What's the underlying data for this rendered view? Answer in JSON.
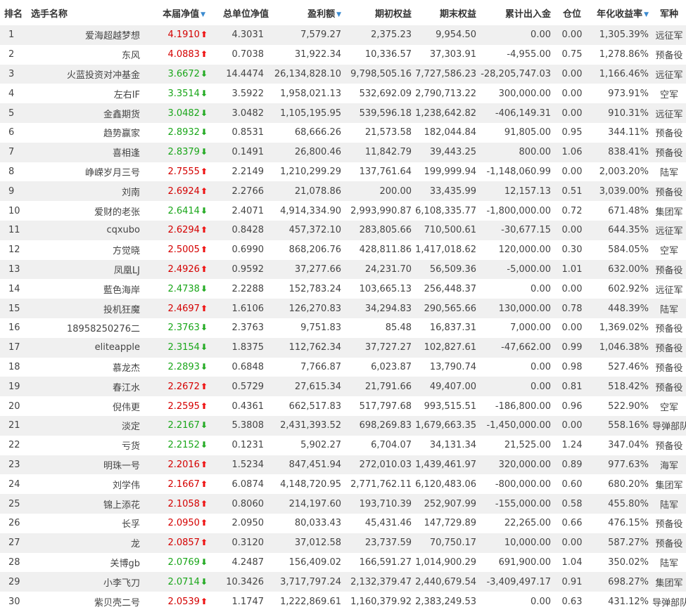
{
  "header": {
    "rank": "排名",
    "name": "选手名称",
    "nav": "本届净值",
    "total_nav": "总单位净值",
    "profit": "盈利额",
    "start_equity": "期初权益",
    "end_equity": "期末权益",
    "net_flow": "累计出入金",
    "position": "仓位",
    "annual_return": "年化收益率",
    "army": "军种"
  },
  "colors": {
    "up": "#d40000",
    "down": "#1aa61a",
    "sort_icon": "#3b8bd0",
    "row_alt": "#f0f0f0"
  },
  "rows": [
    {
      "rank": "1",
      "name": "爱海超越梦想",
      "nav": "4.1910",
      "trend": "up",
      "total_nav": "4.3031",
      "profit": "7,579.27",
      "start": "2,375.23",
      "end": "9,954.50",
      "flow": "0.00",
      "pos": "0.00",
      "annual": "1,305.39%",
      "army": "远征军"
    },
    {
      "rank": "2",
      "name": "东风",
      "nav": "4.0883",
      "trend": "up",
      "total_nav": "0.7038",
      "profit": "31,922.34",
      "start": "10,336.57",
      "end": "37,303.91",
      "flow": "-4,955.00",
      "pos": "0.75",
      "annual": "1,278.86%",
      "army": "预备役"
    },
    {
      "rank": "3",
      "name": "火蓝投资对冲基金",
      "nav": "3.6672",
      "trend": "down",
      "total_nav": "14.4474",
      "profit": "26,134,828.10",
      "start": "9,798,505.16",
      "end": "7,727,586.23",
      "flow": "-28,205,747.03",
      "pos": "0.00",
      "annual": "1,166.46%",
      "army": "远征军"
    },
    {
      "rank": "4",
      "name": "左右IF",
      "nav": "3.3514",
      "trend": "down",
      "total_nav": "3.5922",
      "profit": "1,958,021.13",
      "start": "532,692.09",
      "end": "2,790,713.22",
      "flow": "300,000.00",
      "pos": "0.00",
      "annual": "973.91%",
      "army": "空军"
    },
    {
      "rank": "5",
      "name": "金鑫期货",
      "nav": "3.0482",
      "trend": "down",
      "total_nav": "3.0482",
      "profit": "1,105,195.95",
      "start": "539,596.18",
      "end": "1,238,642.82",
      "flow": "-406,149.31",
      "pos": "0.00",
      "annual": "910.31%",
      "army": "远征军"
    },
    {
      "rank": "6",
      "name": "趋势赢家",
      "nav": "2.8932",
      "trend": "down",
      "total_nav": "0.8531",
      "profit": "68,666.26",
      "start": "21,573.58",
      "end": "182,044.84",
      "flow": "91,805.00",
      "pos": "0.95",
      "annual": "344.11%",
      "army": "预备役"
    },
    {
      "rank": "7",
      "name": "喜相逢",
      "nav": "2.8379",
      "trend": "down",
      "total_nav": "0.1491",
      "profit": "26,800.46",
      "start": "11,842.79",
      "end": "39,443.25",
      "flow": "800.00",
      "pos": "1.06",
      "annual": "838.41%",
      "army": "预备役"
    },
    {
      "rank": "8",
      "name": "峥嵘岁月三号",
      "nav": "2.7555",
      "trend": "up",
      "total_nav": "2.2149",
      "profit": "1,210,299.29",
      "start": "137,761.64",
      "end": "199,999.94",
      "flow": "-1,148,060.99",
      "pos": "0.00",
      "annual": "2,003.20%",
      "army": "陆军"
    },
    {
      "rank": "9",
      "name": "刘南",
      "nav": "2.6924",
      "trend": "up",
      "total_nav": "2.2766",
      "profit": "21,078.86",
      "start": "200.00",
      "end": "33,435.99",
      "flow": "12,157.13",
      "pos": "0.51",
      "annual": "3,039.00%",
      "army": "预备役"
    },
    {
      "rank": "10",
      "name": "爱财的老张",
      "nav": "2.6414",
      "trend": "down",
      "total_nav": "2.4071",
      "profit": "4,914,334.90",
      "start": "2,993,990.87",
      "end": "6,108,335.77",
      "flow": "-1,800,000.00",
      "pos": "0.72",
      "annual": "671.48%",
      "army": "集团军"
    },
    {
      "rank": "11",
      "name": "cqxubo",
      "nav": "2.6294",
      "trend": "up",
      "total_nav": "0.8428",
      "profit": "457,372.10",
      "start": "283,805.66",
      "end": "710,500.61",
      "flow": "-30,677.15",
      "pos": "0.00",
      "annual": "644.35%",
      "army": "远征军"
    },
    {
      "rank": "12",
      "name": "方觉晓",
      "nav": "2.5005",
      "trend": "up",
      "total_nav": "0.6990",
      "profit": "868,206.76",
      "start": "428,811.86",
      "end": "1,417,018.62",
      "flow": "120,000.00",
      "pos": "0.30",
      "annual": "584.05%",
      "army": "空军"
    },
    {
      "rank": "13",
      "name": "凤凰LJ",
      "nav": "2.4926",
      "trend": "up",
      "total_nav": "0.9592",
      "profit": "37,277.66",
      "start": "24,231.70",
      "end": "56,509.36",
      "flow": "-5,000.00",
      "pos": "1.01",
      "annual": "632.00%",
      "army": "预备役"
    },
    {
      "rank": "14",
      "name": "藍色海岸",
      "nav": "2.4738",
      "trend": "down",
      "total_nav": "2.2288",
      "profit": "152,783.24",
      "start": "103,665.13",
      "end": "256,448.37",
      "flow": "0.00",
      "pos": "0.00",
      "annual": "602.92%",
      "army": "远征军"
    },
    {
      "rank": "15",
      "name": "投机狂魔",
      "nav": "2.4697",
      "trend": "up",
      "total_nav": "1.6106",
      "profit": "126,270.83",
      "start": "34,294.83",
      "end": "290,565.66",
      "flow": "130,000.00",
      "pos": "0.78",
      "annual": "448.39%",
      "army": "陆军"
    },
    {
      "rank": "16",
      "name": "18958250276二",
      "nav": "2.3763",
      "trend": "down",
      "total_nav": "2.3763",
      "profit": "9,751.83",
      "start": "85.48",
      "end": "16,837.31",
      "flow": "7,000.00",
      "pos": "0.00",
      "annual": "1,369.02%",
      "army": "预备役"
    },
    {
      "rank": "17",
      "name": "eliteapple",
      "nav": "2.3154",
      "trend": "down",
      "total_nav": "1.8375",
      "profit": "112,762.34",
      "start": "37,727.27",
      "end": "102,827.61",
      "flow": "-47,662.00",
      "pos": "0.99",
      "annual": "1,046.38%",
      "army": "预备役"
    },
    {
      "rank": "18",
      "name": "慕龙杰",
      "nav": "2.2893",
      "trend": "down",
      "total_nav": "0.6848",
      "profit": "7,766.87",
      "start": "6,023.87",
      "end": "13,790.74",
      "flow": "0.00",
      "pos": "0.98",
      "annual": "527.46%",
      "army": "预备役"
    },
    {
      "rank": "19",
      "name": "春江水",
      "nav": "2.2672",
      "trend": "up",
      "total_nav": "0.5729",
      "profit": "27,615.34",
      "start": "21,791.66",
      "end": "49,407.00",
      "flow": "0.00",
      "pos": "0.81",
      "annual": "518.42%",
      "army": "预备役"
    },
    {
      "rank": "20",
      "name": "倪伟更",
      "nav": "2.2595",
      "trend": "up",
      "total_nav": "0.4361",
      "profit": "662,517.83",
      "start": "517,797.68",
      "end": "993,515.51",
      "flow": "-186,800.00",
      "pos": "0.96",
      "annual": "522.90%",
      "army": "空军"
    },
    {
      "rank": "21",
      "name": "淡定",
      "nav": "2.2167",
      "trend": "down",
      "total_nav": "5.3808",
      "profit": "2,431,393.52",
      "start": "698,269.83",
      "end": "1,679,663.35",
      "flow": "-1,450,000.00",
      "pos": "0.00",
      "annual": "558.16%",
      "army": "导弹部队"
    },
    {
      "rank": "22",
      "name": "亏货",
      "nav": "2.2152",
      "trend": "down",
      "total_nav": "0.1231",
      "profit": "5,902.27",
      "start": "6,704.07",
      "end": "34,131.34",
      "flow": "21,525.00",
      "pos": "1.24",
      "annual": "347.04%",
      "army": "预备役"
    },
    {
      "rank": "23",
      "name": "明珠一号",
      "nav": "2.2016",
      "trend": "up",
      "total_nav": "1.5234",
      "profit": "847,451.94",
      "start": "272,010.03",
      "end": "1,439,461.97",
      "flow": "320,000.00",
      "pos": "0.89",
      "annual": "977.63%",
      "army": "海军"
    },
    {
      "rank": "24",
      "name": "刘学伟",
      "nav": "2.1667",
      "trend": "up",
      "total_nav": "6.0874",
      "profit": "4,148,720.95",
      "start": "2,771,762.11",
      "end": "6,120,483.06",
      "flow": "-800,000.00",
      "pos": "0.60",
      "annual": "680.20%",
      "army": "集团军"
    },
    {
      "rank": "25",
      "name": "锦上添花",
      "nav": "2.1058",
      "trend": "up",
      "total_nav": "0.8060",
      "profit": "214,197.60",
      "start": "193,710.39",
      "end": "252,907.99",
      "flow": "-155,000.00",
      "pos": "0.58",
      "annual": "455.80%",
      "army": "陆军"
    },
    {
      "rank": "26",
      "name": "长孚",
      "nav": "2.0950",
      "trend": "up",
      "total_nav": "2.0950",
      "profit": "80,033.43",
      "start": "45,431.46",
      "end": "147,729.89",
      "flow": "22,265.00",
      "pos": "0.66",
      "annual": "476.15%",
      "army": "预备役"
    },
    {
      "rank": "27",
      "name": "龙",
      "nav": "2.0857",
      "trend": "up",
      "total_nav": "0.3120",
      "profit": "37,012.58",
      "start": "23,737.59",
      "end": "70,750.17",
      "flow": "10,000.00",
      "pos": "0.00",
      "annual": "587.27%",
      "army": "预备役"
    },
    {
      "rank": "28",
      "name": "关博gb",
      "nav": "2.0769",
      "trend": "down",
      "total_nav": "4.2487",
      "profit": "156,409.02",
      "start": "166,591.27",
      "end": "1,014,900.29",
      "flow": "691,900.00",
      "pos": "1.04",
      "annual": "350.02%",
      "army": "陆军"
    },
    {
      "rank": "29",
      "name": "小李飞刀",
      "nav": "2.0714",
      "trend": "down",
      "total_nav": "10.3426",
      "profit": "3,717,797.24",
      "start": "2,132,379.47",
      "end": "2,440,679.54",
      "flow": "-3,409,497.17",
      "pos": "0.91",
      "annual": "698.27%",
      "army": "集团军"
    },
    {
      "rank": "30",
      "name": "紫贝壳二号",
      "nav": "2.0539",
      "trend": "up",
      "total_nav": "1.1747",
      "profit": "1,222,869.61",
      "start": "1,160,379.92",
      "end": "2,383,249.53",
      "flow": "0.00",
      "pos": "0.63",
      "annual": "431.12%",
      "army": "导弹部队"
    }
  ]
}
